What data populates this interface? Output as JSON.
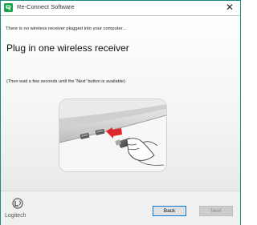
{
  "window": {
    "title": "Re-Connect Software",
    "close_glyph": "✕"
  },
  "main": {
    "notice": "There is no wireless receiver plugged into your computer...",
    "heading": "Plug in one wireless receiver",
    "hint": "(Then wait a few seconds until the 'Next' button is available)"
  },
  "illustration": {
    "icon": "usb-receiver-plugging-icon",
    "arrow_color": "#e0242b"
  },
  "footer": {
    "logo_text": "Logitech",
    "back_label": "Back",
    "next_label": "Next",
    "accent_color": "#0078d7"
  }
}
